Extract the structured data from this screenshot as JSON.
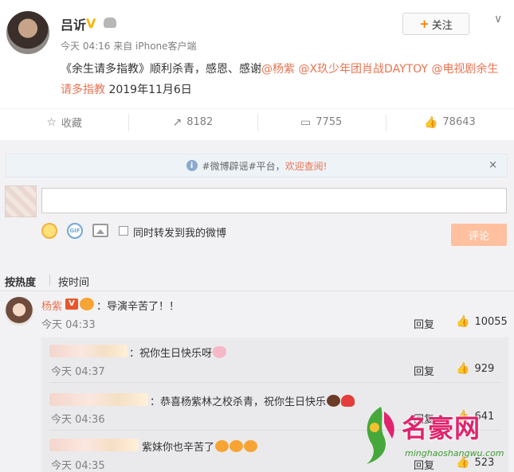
{
  "post": {
    "author": "吕䜣",
    "verified_mark": "V",
    "meta": "今天 04:16 来自 iPhone客户端",
    "follow_label": "关注",
    "content_prefix": "《余生请多指教》顺利杀青，感恩、感谢",
    "mention_1": "@杨紫",
    "mention_2": "@X玖少年团肖战DAYTOY",
    "mention_3": "@电视剧余生请多指教",
    "content_suffix": "2019年11月6日"
  },
  "actions": {
    "favorite": "收藏",
    "repost": "8182",
    "comment": "7755",
    "like": "78643"
  },
  "notice": {
    "text": "#微博辟谣#平台，",
    "highlight": "欢迎查阅!",
    "close": "×"
  },
  "composer": {
    "input_value": "",
    "gif_label": "GIF",
    "repost_label": "同时转发到我的微博",
    "submit_label": "评论"
  },
  "sort": {
    "hot": "按热度",
    "time": "按时间"
  },
  "top_comment": {
    "user": "杨紫",
    "badge": "V",
    "text": "：导演辛苦了！！",
    "time": "今天 04:33",
    "reply": "回复",
    "likes": "10055"
  },
  "sub_comments": [
    {
      "text": "：祝你生日快乐呀",
      "time": "今天 04:37",
      "reply": "回复",
      "likes": "929"
    },
    {
      "text": "：恭喜杨紫林之校杀青，祝你生日快乐",
      "time": "今天 04:36",
      "reply": "回复",
      "likes": "641"
    },
    {
      "text": "紫妹你也辛苦了",
      "time": "今天 04:35",
      "reply": "回复",
      "likes": "523"
    }
  ],
  "watermark": {
    "title": "名豪网",
    "url": "minghaoshangwu.com"
  },
  "colors": {
    "link": "#eb7350",
    "accent": "#ff8200",
    "submit_disabled": "#ffc09f",
    "watermark": "#e0246e"
  }
}
